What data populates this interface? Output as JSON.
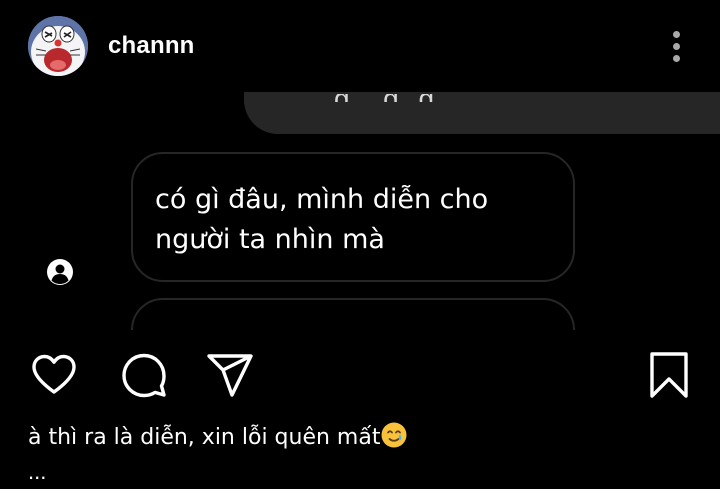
{
  "header": {
    "username": "channn",
    "avatar_icon": "doraemon-crying-avatar",
    "more_icon": "more-vertical-icon"
  },
  "chat": {
    "sent_cutoff_text": "…g ,g g .",
    "received_message": "có gì đâu, mình diễn cho người ta nhìn mà",
    "sender_avatar_icon": "person-avatar-icon"
  },
  "actions": {
    "like_icon": "heart-icon",
    "comment_icon": "comment-icon",
    "share_icon": "paper-plane-icon",
    "save_icon": "bookmark-icon"
  },
  "caption": {
    "text": "à thì ra là diễn, xin lỗi quên mất",
    "emoji": "smiling-face-with-tear-emoji",
    "more": "..."
  },
  "colors": {
    "background": "#000000",
    "bubble_sent": "#262626",
    "bubble_border": "#262626",
    "text": "#ffffff",
    "muted_icon": "#a9a9a9"
  }
}
